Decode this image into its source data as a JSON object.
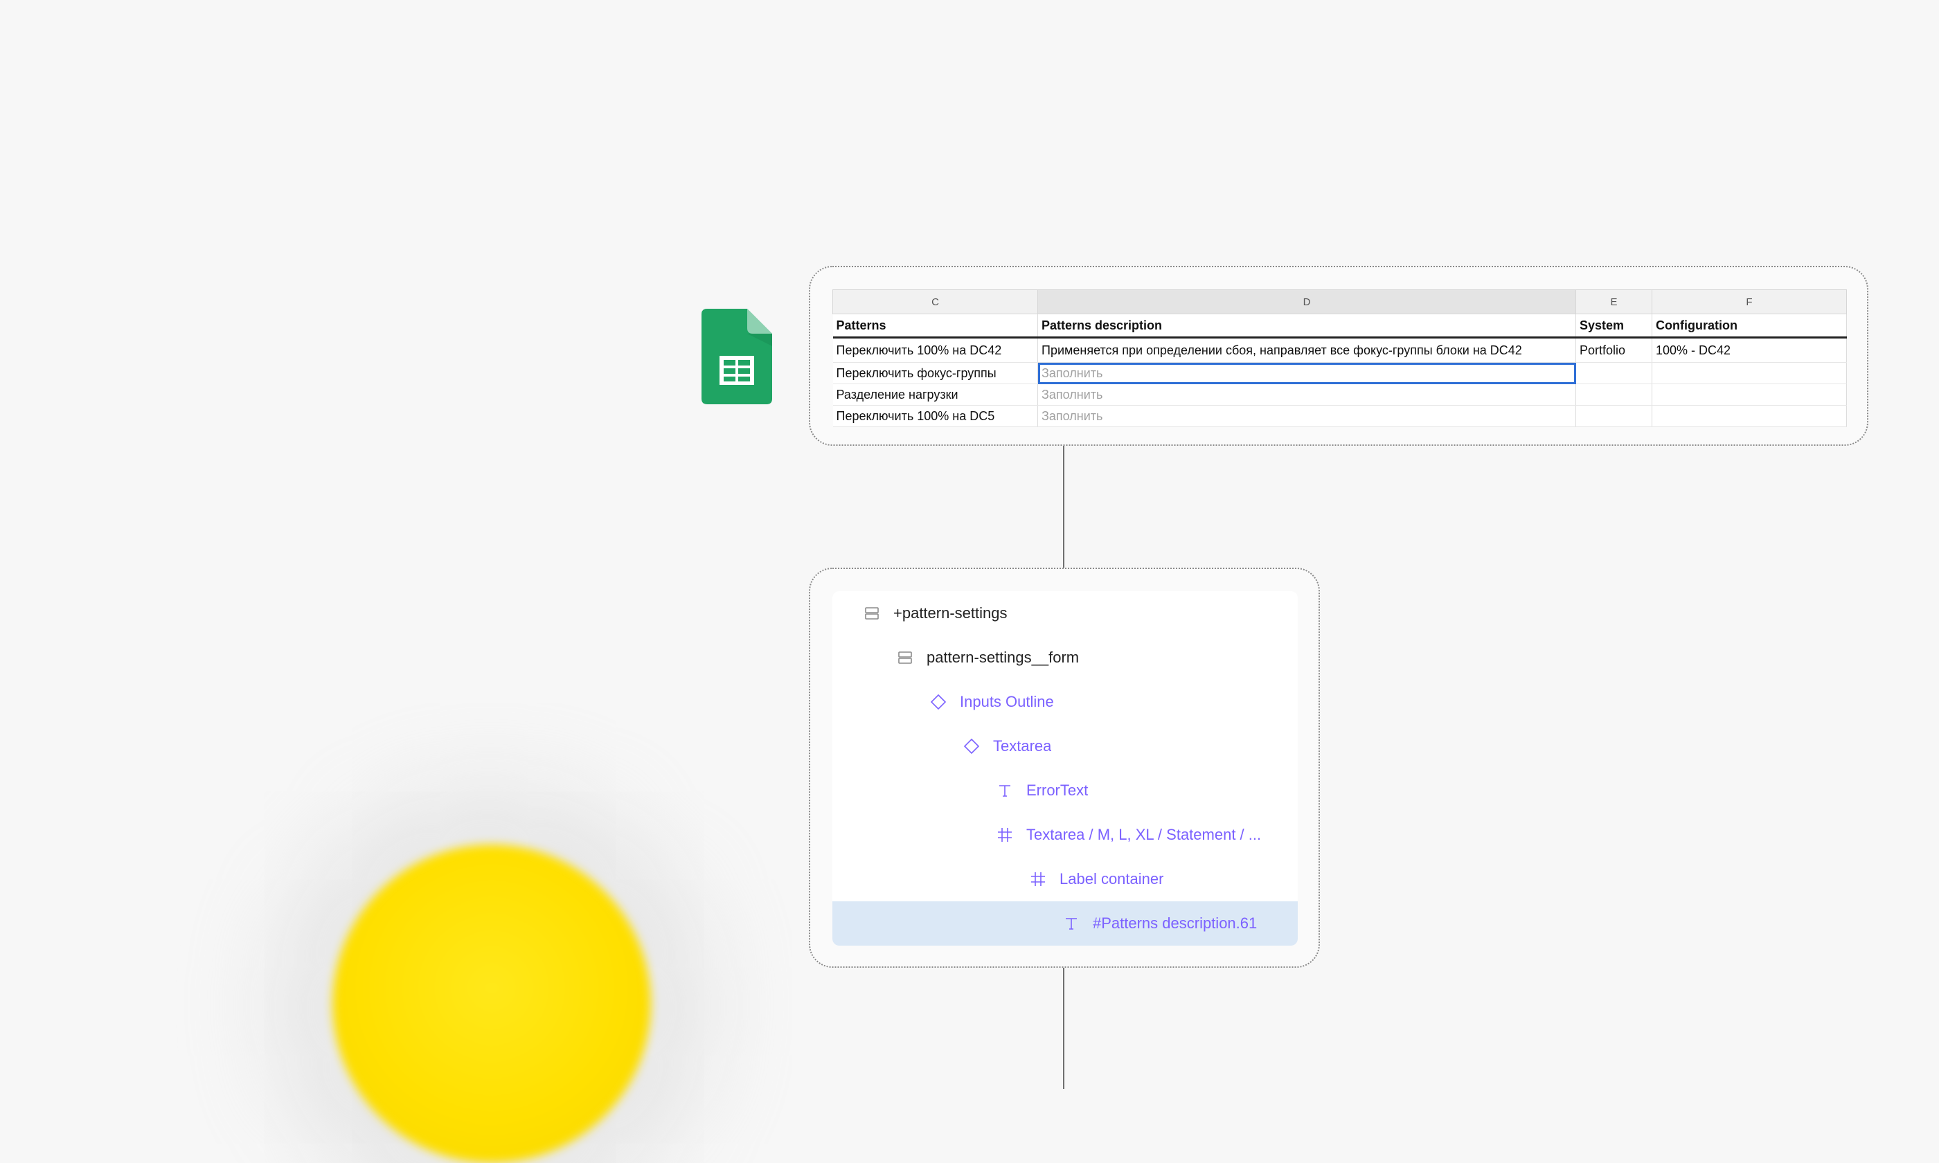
{
  "spreadsheet": {
    "column_letters": [
      "C",
      "D",
      "E",
      "F"
    ],
    "header": [
      "Patterns",
      "Patterns description",
      "System",
      "Configuration"
    ],
    "rows": [
      [
        "Переключить 100% на DC42",
        "Применяется при определении сбоя, направляет все фокус-группы блоки на  DC42",
        "Portfolio",
        "100% - DC42"
      ],
      [
        "Переключить фокус-группы",
        "Заполнить",
        "",
        ""
      ],
      [
        "Разделение нагрузки",
        "Заполнить",
        "",
        ""
      ],
      [
        "Переключить 100% на DC5",
        "Заполнить",
        "",
        ""
      ]
    ]
  },
  "layers": {
    "items": [
      {
        "label": "+pattern-settings",
        "icon": "stack-icon",
        "color": "#222222"
      },
      {
        "label": "pattern-settings__form",
        "icon": "stack-icon",
        "color": "#222222"
      },
      {
        "label": "Inputs Outline",
        "icon": "component-instance-icon",
        "color": "#7b61ff"
      },
      {
        "label": "Textarea",
        "icon": "component-instance-icon",
        "color": "#7b61ff"
      },
      {
        "label": "ErrorText",
        "icon": "text-icon",
        "color": "#7b61ff"
      },
      {
        "label": "Textarea / M, L, XL / Statement / ...",
        "icon": "frame-icon",
        "color": "#7b61ff"
      },
      {
        "label": "Label container",
        "icon": "frame-icon",
        "color": "#7b61ff"
      },
      {
        "label": "#Patterns description.61",
        "icon": "text-icon",
        "color": "#7b61ff",
        "selected": true
      }
    ]
  },
  "colors": {
    "sheets_green": "#1fa463",
    "component_purple": "#7b61ff",
    "selection_blue": "#dbe8f6",
    "active_cell_border": "#2f6fd6",
    "ball_yellow": "#ffe000"
  }
}
